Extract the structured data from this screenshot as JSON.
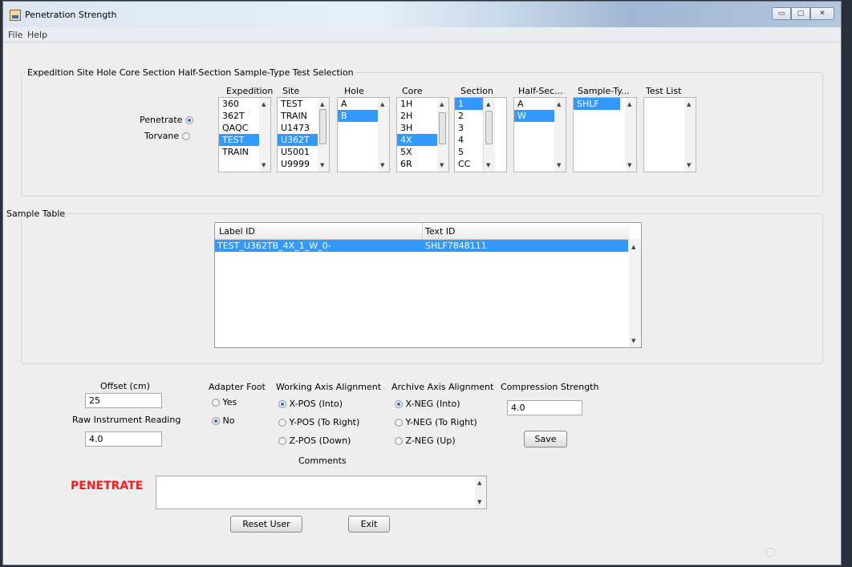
{
  "window": {
    "title": "Penetration Strength",
    "controls": {
      "minimize": "▭",
      "maximize": "▢",
      "close": "✕"
    }
  },
  "menu": {
    "items": [
      "File",
      "Help"
    ]
  },
  "selection": {
    "title": "Expedition Site Hole Core Section Half-Section Sample-Type Test Selection",
    "modes": [
      {
        "label": "Penetrate",
        "selected": true
      },
      {
        "label": "Torvane",
        "selected": false
      }
    ],
    "columns": [
      {
        "header": "Expedition",
        "items": [
          "360",
          "362T",
          "QAQC",
          "TEST",
          "TRAIN"
        ],
        "selected_index": 3
      },
      {
        "header": "Site",
        "items": [
          "TEST",
          "TRAIN",
          "U1473",
          "U362T",
          "U5001",
          "U9999"
        ],
        "selected_index": 3
      },
      {
        "header": "Hole",
        "items": [
          "A",
          "B"
        ],
        "selected_index": 1
      },
      {
        "header": "Core",
        "items": [
          "1H",
          "2H",
          "3H",
          "4X",
          "5X",
          "6R"
        ],
        "selected_index": 3
      },
      {
        "header": "Section",
        "items": [
          "1",
          "2",
          "3",
          "4",
          "5",
          "CC"
        ],
        "selected_index": 0
      },
      {
        "header": "Half-Sec...",
        "items": [
          "A",
          "W"
        ],
        "selected_index": 1
      },
      {
        "header": "Sample-Ty...",
        "items": [
          "SHLF"
        ],
        "selected_index": 0
      },
      {
        "header": "Test List",
        "items": [],
        "selected_index": -1
      }
    ]
  },
  "sample_table": {
    "title": "Sample Table",
    "headers": [
      "Label ID",
      "Text ID"
    ],
    "rows": [
      {
        "label_id": "TEST_U362TB_4X_1_W_0-",
        "text_id": "SHLF7848111",
        "selected": true
      }
    ]
  },
  "form": {
    "offset_label": "Offset (cm)",
    "offset_value": "25",
    "raw_label": "Raw Instrument Reading",
    "raw_value": "4.0",
    "status_text": "PENETRATE",
    "adapter_foot": {
      "label": "Adapter Foot",
      "options": [
        "Yes",
        "No"
      ],
      "selected": "No"
    },
    "working_axis": {
      "label": "Working Axis Alignment",
      "options": [
        "X-POS (Into)",
        "Y-POS (To Right)",
        "Z-POS (Down)"
      ],
      "selected": "X-POS (Into)"
    },
    "archive_axis": {
      "label": "Archive Axis Alignment",
      "options": [
        "X-NEG (Into)",
        "Y-NEG (To Right)",
        "Z-NEG (Up)"
      ],
      "selected": "X-NEG (Into)"
    },
    "compression_label": "Compression Strength",
    "compression_value": "4.0",
    "save_label": "Save",
    "comments_label": "Comments",
    "comments_value": "",
    "reset_label": "Reset User",
    "exit_label": "Exit"
  },
  "colors": {
    "selection": "#3399ff",
    "status_red": "#ff1a1a"
  }
}
